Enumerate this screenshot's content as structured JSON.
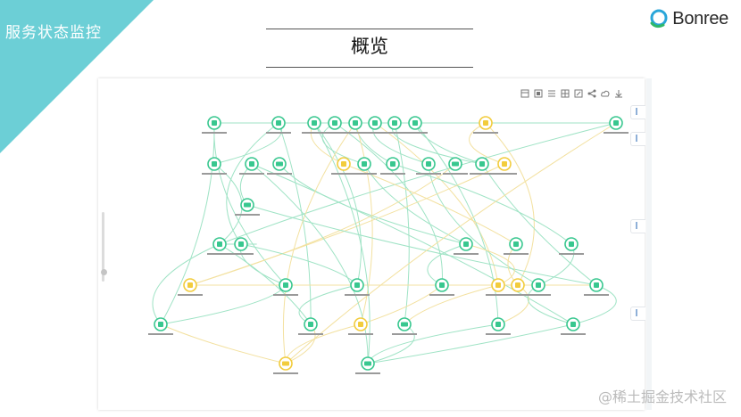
{
  "slide": {
    "corner_title": "服务状态监控",
    "heading": "概览",
    "logo_text": "Bonree",
    "watermark": "@稀土掘金技术社区",
    "colors": {
      "corner_band": "#6ccfd6",
      "node_ok": "#38c78f",
      "node_warn": "#f2cc3c",
      "edge_ok": "#9fe3c5",
      "edge_warn": "#f3e1a0"
    }
  },
  "topology": {
    "toolbar_icons": [
      "layout-icon",
      "fit-view-icon",
      "list-icon",
      "grid-icon",
      "refresh-icon",
      "share-icon",
      "cloud-icon",
      "download-icon"
    ],
    "nodes": [
      {
        "id": "n1",
        "status": "ok",
        "kind": "service",
        "icon": "service-icon"
      },
      {
        "id": "n2",
        "status": "ok",
        "kind": "service",
        "icon": "service-icon"
      },
      {
        "id": "n3",
        "status": "ok",
        "kind": "service",
        "icon": "service-icon"
      },
      {
        "id": "n4",
        "status": "ok",
        "kind": "service",
        "icon": "service-icon"
      },
      {
        "id": "n5",
        "status": "ok",
        "kind": "service",
        "icon": "service-icon"
      },
      {
        "id": "n6",
        "status": "ok",
        "kind": "service",
        "icon": "service-icon"
      },
      {
        "id": "n7",
        "status": "ok",
        "kind": "service",
        "icon": "service-icon"
      },
      {
        "id": "n8",
        "status": "ok",
        "kind": "service",
        "icon": "service-icon"
      },
      {
        "id": "n9",
        "status": "warn",
        "kind": "service",
        "icon": "service-icon"
      },
      {
        "id": "n10",
        "status": "ok",
        "kind": "service",
        "icon": "service-icon"
      },
      {
        "id": "n11",
        "status": "ok",
        "kind": "service",
        "icon": "service-icon"
      },
      {
        "id": "n12",
        "status": "ok",
        "kind": "service",
        "icon": "service-icon"
      },
      {
        "id": "n13",
        "status": "ok",
        "kind": "database",
        "icon": "database-icon"
      },
      {
        "id": "n14",
        "status": "warn",
        "kind": "service",
        "icon": "service-icon"
      },
      {
        "id": "n15",
        "status": "ok",
        "kind": "service",
        "icon": "service-icon"
      },
      {
        "id": "n16",
        "status": "ok",
        "kind": "service",
        "icon": "service-icon"
      },
      {
        "id": "n17",
        "status": "ok",
        "kind": "service",
        "icon": "service-icon"
      },
      {
        "id": "n18",
        "status": "ok",
        "kind": "database",
        "icon": "database-icon"
      },
      {
        "id": "n19",
        "status": "ok",
        "kind": "service",
        "icon": "service-icon"
      },
      {
        "id": "n20",
        "status": "warn",
        "kind": "service",
        "icon": "service-icon"
      },
      {
        "id": "n21",
        "status": "ok",
        "kind": "database",
        "icon": "database-icon"
      },
      {
        "id": "n22",
        "status": "ok",
        "kind": "service",
        "icon": "service-icon"
      },
      {
        "id": "n23",
        "status": "ok",
        "kind": "service",
        "icon": "service-icon"
      },
      {
        "id": "n24",
        "status": "ok",
        "kind": "service",
        "icon": "service-icon"
      },
      {
        "id": "n25",
        "status": "ok",
        "kind": "service",
        "icon": "service-icon"
      },
      {
        "id": "n26",
        "status": "ok",
        "kind": "service",
        "icon": "service-icon"
      },
      {
        "id": "n27",
        "status": "warn",
        "kind": "service",
        "icon": "service-icon"
      },
      {
        "id": "n28",
        "status": "ok",
        "kind": "service",
        "icon": "service-icon"
      },
      {
        "id": "n29",
        "status": "ok",
        "kind": "service",
        "icon": "service-icon"
      },
      {
        "id": "n30",
        "status": "ok",
        "kind": "service",
        "icon": "service-icon"
      },
      {
        "id": "n31",
        "status": "warn",
        "kind": "service",
        "icon": "service-icon"
      },
      {
        "id": "n32",
        "status": "warn",
        "kind": "service",
        "icon": "service-icon"
      },
      {
        "id": "n33",
        "status": "ok",
        "kind": "service",
        "icon": "service-icon"
      },
      {
        "id": "n34",
        "status": "ok",
        "kind": "service",
        "icon": "service-icon"
      },
      {
        "id": "n35",
        "status": "ok",
        "kind": "service",
        "icon": "service-icon"
      },
      {
        "id": "n36",
        "status": "ok",
        "kind": "service",
        "icon": "service-icon"
      },
      {
        "id": "n37",
        "status": "warn",
        "kind": "service",
        "icon": "service-icon"
      },
      {
        "id": "n38",
        "status": "ok",
        "kind": "database",
        "icon": "database-icon"
      },
      {
        "id": "n39",
        "status": "ok",
        "kind": "service",
        "icon": "service-icon"
      },
      {
        "id": "n40",
        "status": "ok",
        "kind": "service",
        "icon": "service-icon"
      },
      {
        "id": "n41",
        "status": "warn",
        "kind": "database",
        "icon": "database-icon"
      },
      {
        "id": "n42",
        "status": "ok",
        "kind": "database",
        "icon": "database-icon"
      }
    ],
    "edges": [
      [
        "n1",
        "n10"
      ],
      [
        "n1",
        "n35"
      ],
      [
        "n1",
        "n28"
      ],
      [
        "n2",
        "n11"
      ],
      [
        "n2",
        "n23"
      ],
      [
        "n2",
        "n36"
      ],
      [
        "n3",
        "n14"
      ],
      [
        "n3",
        "n29"
      ],
      [
        "n4",
        "n15"
      ],
      [
        "n4",
        "n30"
      ],
      [
        "n5",
        "n16"
      ],
      [
        "n5",
        "n37"
      ],
      [
        "n6",
        "n17"
      ],
      [
        "n6",
        "n31"
      ],
      [
        "n7",
        "n19"
      ],
      [
        "n7",
        "n38"
      ],
      [
        "n8",
        "n19"
      ],
      [
        "n8",
        "n39"
      ],
      [
        "n9",
        "n20"
      ],
      [
        "n9",
        "n32"
      ],
      [
        "n12",
        "n21"
      ],
      [
        "n12",
        "n40"
      ],
      [
        "n10",
        "n22"
      ],
      [
        "n11",
        "n22"
      ],
      [
        "n13",
        "n24"
      ],
      [
        "n14",
        "n25"
      ],
      [
        "n15",
        "n24"
      ],
      [
        "n16",
        "n26"
      ],
      [
        "n17",
        "n33"
      ],
      [
        "n18",
        "n27"
      ],
      [
        "n19",
        "n34"
      ],
      [
        "n20",
        "n27"
      ],
      [
        "n21",
        "n34"
      ],
      [
        "n22",
        "n23"
      ],
      [
        "n22",
        "n35"
      ],
      [
        "n22",
        "n36"
      ],
      [
        "n23",
        "n28"
      ],
      [
        "n23",
        "n29"
      ],
      [
        "n24",
        "n30"
      ],
      [
        "n24",
        "n31"
      ],
      [
        "n25",
        "n32"
      ],
      [
        "n26",
        "n33"
      ],
      [
        "n27",
        "n34"
      ],
      [
        "n28",
        "n35"
      ],
      [
        "n29",
        "n36"
      ],
      [
        "n30",
        "n37"
      ],
      [
        "n31",
        "n38"
      ],
      [
        "n32",
        "n39"
      ],
      [
        "n33",
        "n40"
      ],
      [
        "n34",
        "n40"
      ],
      [
        "n35",
        "n41"
      ],
      [
        "n36",
        "n41"
      ],
      [
        "n37",
        "n41"
      ],
      [
        "n38",
        "n42"
      ],
      [
        "n39",
        "n42"
      ],
      [
        "n40",
        "n42"
      ],
      [
        "n10",
        "n41"
      ],
      [
        "n3",
        "n42"
      ],
      [
        "n5",
        "n41"
      ],
      [
        "n12",
        "n42"
      ]
    ]
  }
}
